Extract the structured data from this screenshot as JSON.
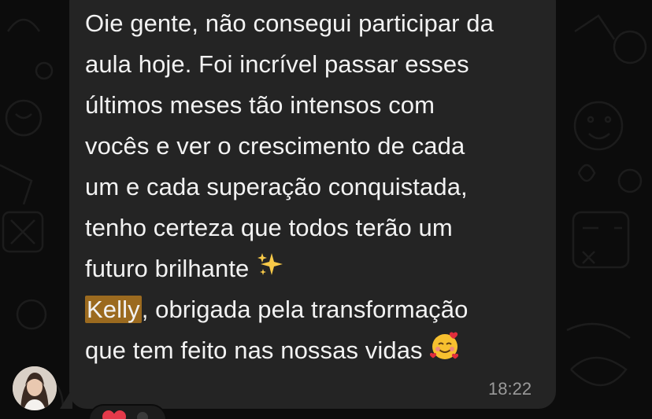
{
  "message": {
    "lines": [
      "Oie gente, não consegui participar da",
      "aula hoje. Foi incrível passar esses",
      "últimos meses tão intensos com",
      "vocês e ver o crescimento de cada",
      "um e cada superação conquistada,",
      "tenho certeza que todos terão um",
      "futuro brilhante "
    ],
    "mention": "Kelly",
    "after_mention": ", obrigada pela transformação",
    "last_line": "que tem feito nas nossas vidas ",
    "timestamp": "18:22"
  },
  "icons": {
    "sparkles": "sparkles-icon",
    "smiling_face_with_hearts": "smiling-face-with-hearts-icon",
    "reaction": "heart-icon"
  },
  "colors": {
    "background": "#0c0c0c",
    "bubble": "#242424",
    "text": "#f2f2f2",
    "mention_highlight": "#9b6a1f",
    "timestamp": "#9a9a9a"
  }
}
